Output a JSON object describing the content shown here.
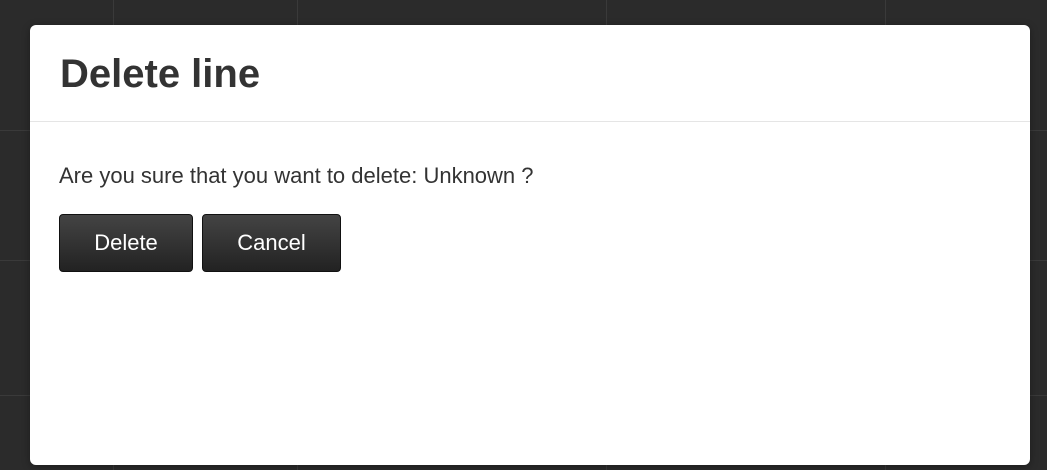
{
  "dialog": {
    "title": "Delete line",
    "message": "Are you sure that you want to delete: Unknown ?",
    "buttons": {
      "delete_label": "Delete",
      "cancel_label": "Cancel"
    }
  },
  "colors": {
    "backdrop": "#2b2b2b",
    "dialog_background": "#ffffff",
    "text": "#333333",
    "button_background": "#2a2a2a",
    "button_text": "#ffffff"
  }
}
